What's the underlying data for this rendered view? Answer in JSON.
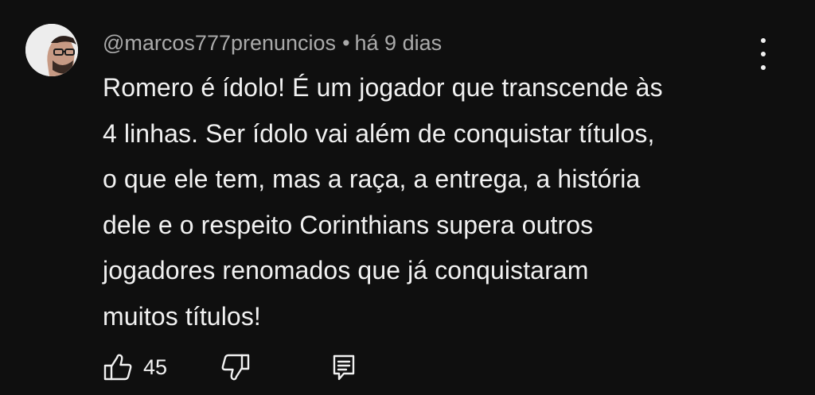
{
  "comment": {
    "author": "@marcos777prenuncios",
    "separator": "•",
    "timestamp": "há 9 dias",
    "text_lines": [
      "Romero é ídolo! É um jogador que transcende às",
      "4 linhas. Ser ídolo vai além de conquistar títulos,",
      "o que ele tem, mas a raça, a entrega, a história",
      "dele e o respeito Corinthians supera outros",
      "jogadores renomados que já conquistaram",
      "muitos títulos!"
    ],
    "like_count": "45"
  },
  "icons": {
    "like": "thumbs-up-icon",
    "dislike": "thumbs-down-icon",
    "reply": "comment-reply-icon",
    "menu": "more-vertical-icon"
  },
  "colors": {
    "background": "#0f0f0f",
    "text_primary": "#f1f1f1",
    "text_secondary": "#aaaaaa"
  }
}
